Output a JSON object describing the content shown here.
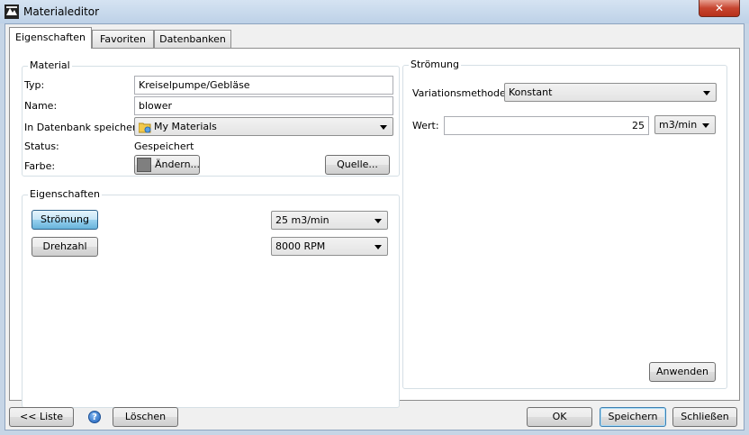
{
  "window": {
    "title": "Materialeditor",
    "close_label": "✕"
  },
  "tabs": [
    {
      "label": "Eigenschaften",
      "active": true
    },
    {
      "label": "Favoriten",
      "active": false
    },
    {
      "label": "Datenbanken",
      "active": false
    }
  ],
  "material": {
    "group_title": "Material",
    "typ_label": "Typ:",
    "typ_value": "Kreiselpumpe/Gebläse",
    "name_label": "Name:",
    "name_value": "blower",
    "db_label": "In Datenbank speichern:",
    "db_value": "My Materials",
    "status_label": "Status:",
    "status_value": "Gespeichert",
    "farbe_label": "Farbe:",
    "aendern_label": "Ändern...",
    "quelle_label": "Quelle...",
    "swatch_color": "#7f7f7f"
  },
  "eigenschaften": {
    "group_title": "Eigenschaften",
    "stroemung_button": "Strömung",
    "stroemung_value": "25 m3/min",
    "drehzahl_button": "Drehzahl",
    "drehzahl_value": "8000 RPM"
  },
  "stroemung": {
    "group_title": "Strömung",
    "variation_label": "Variationsmethode:",
    "variation_value": "Konstant",
    "wert_label": "Wert:",
    "wert_value": "25",
    "unit_value": "m3/min",
    "anwenden_label": "Anwenden"
  },
  "footer": {
    "liste_label": "<< Liste",
    "help_icon": "?",
    "loeschen_label": "Löschen",
    "ok_label": "OK",
    "speichern_label": "Speichern",
    "schliessen_label": "Schließen"
  },
  "colors": {
    "accent": "#68b3db",
    "window_frame": "#c6d5e6",
    "close": "#c7452f"
  }
}
